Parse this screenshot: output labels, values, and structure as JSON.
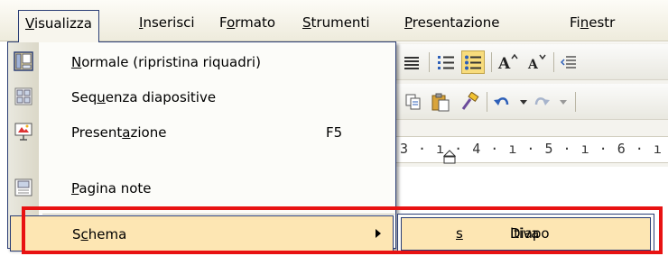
{
  "menubar": {
    "items": [
      {
        "key": "V",
        "rest": "isualizza"
      },
      {
        "key": "I",
        "rest": "nserisci"
      },
      {
        "pre": "F",
        "key": "o",
        "rest": "rmato"
      },
      {
        "key": "S",
        "rest": "trumenti"
      },
      {
        "key": "P",
        "rest": "resentazione"
      },
      {
        "pre": "Fi",
        "key": "n",
        "rest": "estr"
      }
    ]
  },
  "view_menu": {
    "items": [
      {
        "pre": "",
        "key": "N",
        "rest": "ormale (ripristina riquadri)",
        "icon": "normal-view-icon"
      },
      {
        "pre": "Seq",
        "key": "u",
        "rest": "enza diapositive",
        "icon": "slide-sorter-icon"
      },
      {
        "pre": "Present",
        "key": "a",
        "rest": "zione",
        "shortcut": "F5",
        "icon": "slideshow-icon"
      },
      {
        "pre": "",
        "key": "P",
        "rest": "agina note",
        "icon": "notes-page-icon"
      },
      {
        "pre": "S",
        "key": "c",
        "rest": "hema",
        "has_submenu": true
      }
    ]
  },
  "schema_submenu": {
    "items": [
      {
        "pre": "Diapo",
        "key": "s",
        "rest": "itiva"
      }
    ]
  },
  "ruler": {
    "text": "3 · ı · 4 · ı · 5 · ı · 6 · ı ·"
  },
  "colors": {
    "highlight": "#fde6b3",
    "menu_border": "#2a3d75",
    "annotation": "#e81212"
  }
}
